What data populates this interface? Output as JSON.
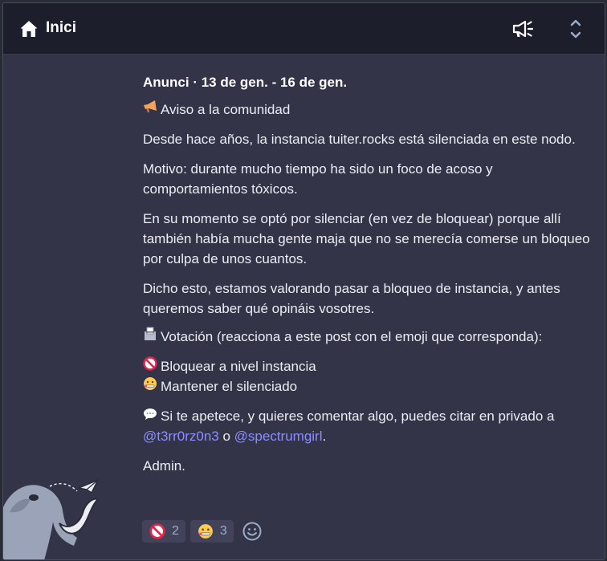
{
  "header": {
    "title": "Inici",
    "home_icon": "home-icon",
    "announcement_icon": "megaphone-icon",
    "collapse_icon": "chevron-up-down-icon"
  },
  "announcement": {
    "meta": "Anunci · 13 de gen. - 16 de gen.",
    "heading": "Aviso a la comunidad",
    "p1": "Desde hace años, la instancia tuiter.rocks está silenciada en este nodo.",
    "p2": "Motivo: durante mucho tiempo ha sido un foco de acoso y comportamientos tóxicos.",
    "p3": "En su momento se optó por silenciar (en vez de bloquear) porque allí también había mucha gente maja que no se merecía comerse un bloqueo por culpa de unos cuantos.",
    "p4": "Dicho esto, estamos valorando pasar a bloqueo de instancia, y antes queremos saber qué opináis vosotres.",
    "vote": "Votación (reacciona a este post con el emoji que corresponda):",
    "option1": "Bloquear a nivel instancia",
    "option2": "Mantener el silenciado",
    "comment_prefix": "Si te apetece, y quieres comentar algo, puedes citar en privado a ",
    "mention1": "@t3rr0rz0n3",
    "comment_middle": " o ",
    "mention2": "@spectrumgirl",
    "comment_suffix": ".",
    "signature": "Admin."
  },
  "reactions": [
    {
      "icon": "no-entry-icon",
      "count": "2"
    },
    {
      "icon": "zipper-mouth-face-icon",
      "count": "3"
    }
  ],
  "colors": {
    "background": "#282c37",
    "panel": "#333447",
    "header": "#1d1e2c",
    "mention": "#8c8dff",
    "reaction_bg": "#42435a"
  }
}
